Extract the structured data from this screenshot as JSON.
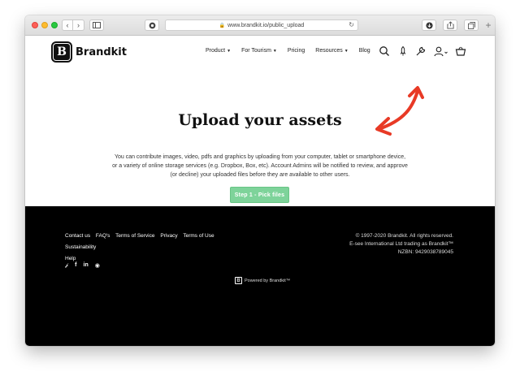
{
  "browser": {
    "url": "www.brandkit.io/public_upload",
    "new_tab_glyph": "+"
  },
  "header": {
    "logo_letter": "B",
    "logo_text": "Brandkit",
    "nav": [
      {
        "label": "Product",
        "caret": true
      },
      {
        "label": "For Tourism",
        "caret": true
      },
      {
        "label": "Pricing",
        "caret": false
      },
      {
        "label": "Resources",
        "caret": true
      },
      {
        "label": "Blog",
        "caret": false
      }
    ],
    "icons": [
      "search-icon",
      "rocket-icon",
      "wrench-icon",
      "user-icon",
      "cart-icon"
    ]
  },
  "main": {
    "title": "Upload your assets",
    "description": "You can contribute images, video, pdfs and graphics by uploading from your computer, tablet or smartphone device, or a variety of online storage services (e.g. Dropbox, Box, etc). Account Admins will be notified to review, and approve (or decline) your uploaded files before they are available to other users.",
    "button_label": "Step 1 - Pick files",
    "button_color": "#7ed39a",
    "annotation_color": "#e83a26"
  },
  "footer": {
    "links": [
      "Contact us",
      "FAQ's",
      "Terms of Service",
      "Privacy",
      "Terms of Use",
      "Sustainability",
      "Help"
    ],
    "social": [
      "twitter-icon",
      "facebook-icon",
      "linkedin-icon",
      "instagram-icon"
    ],
    "copyright_lines": [
      "© 1997-2020 Brandkit. All rights reserved.",
      "E-see International Ltd trading as Brandkit™",
      "NZBN: 9429038789045"
    ],
    "powered_by": "Powered by Brandkit™"
  }
}
